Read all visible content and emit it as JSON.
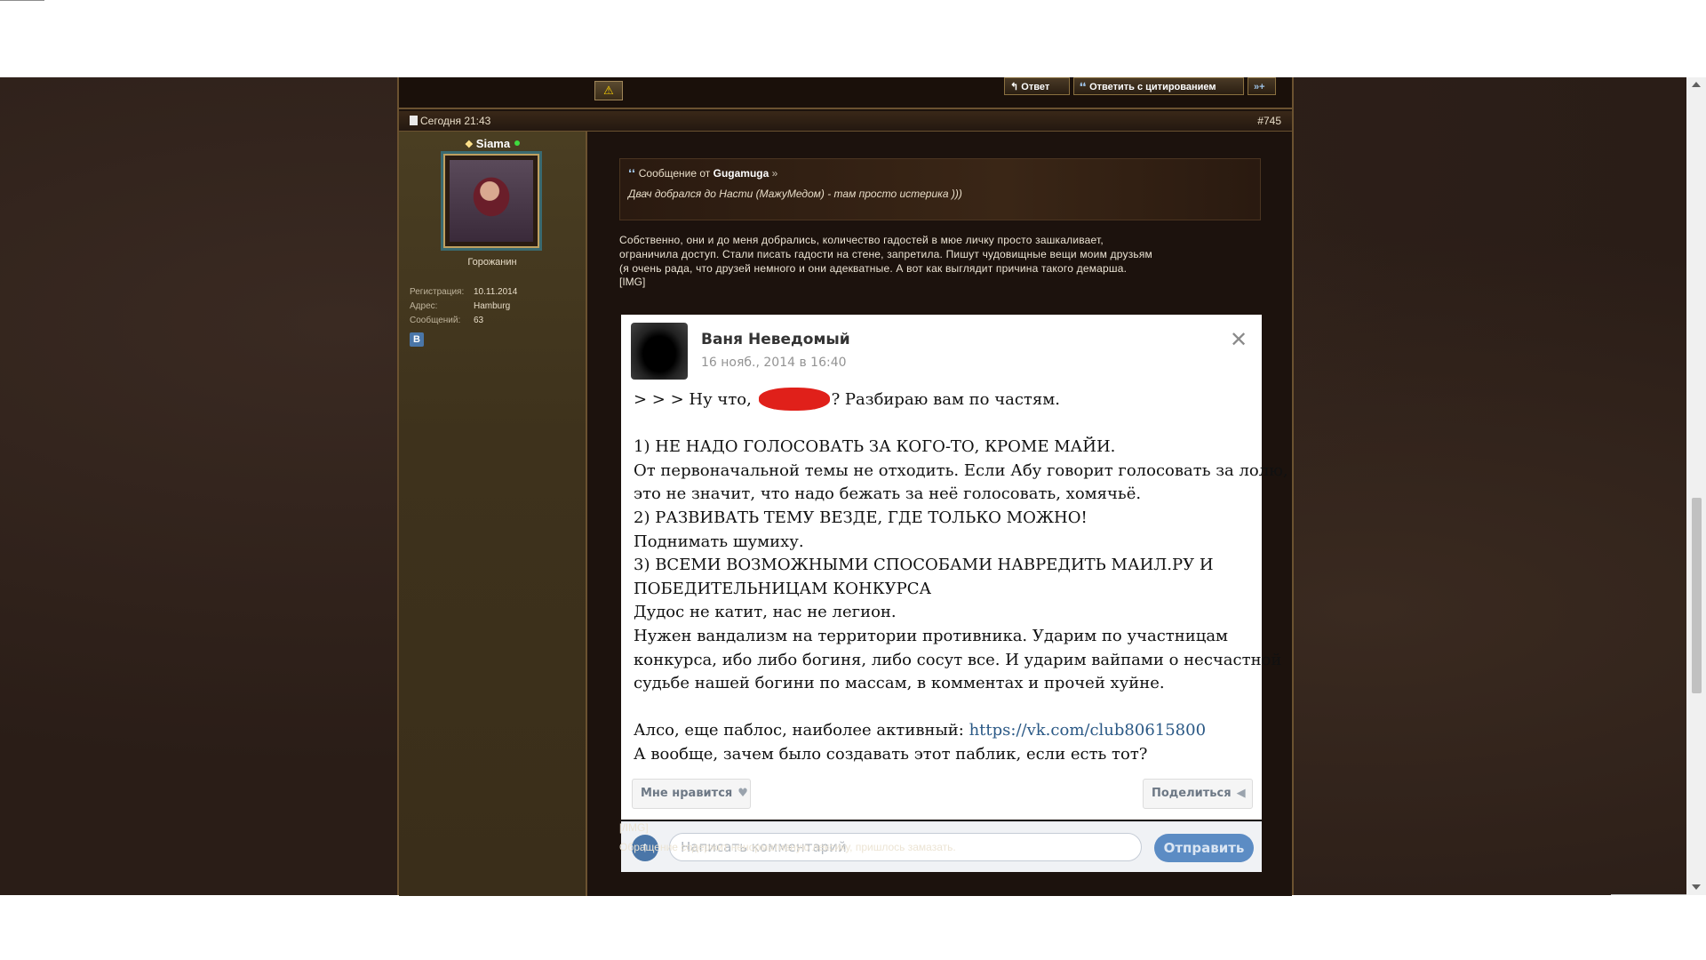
{
  "toolbar": {
    "warn_icon": "warning-icon",
    "reply_label": "Ответ",
    "quote_reply_label": "Ответить с цитированием",
    "multiquote_label": "»+"
  },
  "post": {
    "date": "Сегодня 21:43",
    "number": "#745",
    "quote": {
      "prefix": "Сообщение от",
      "author": "Gugamuga",
      "text": "Двач добрался до Насти (МажуМедом) - там просто истерика )))"
    },
    "body_lines": [
      "Собственно, они и до меня добрались, количество гадостей в мюе личку просто зашкаливает,",
      "ограничила доступ. Стали писать гадости на стене, запретила. Пишут чудовищные вещи моим друзьям",
      "(я очень рада, что друзей немного и они адекватные. А вот как выглядит причина такого демарша."
    ],
    "img_open": "[IMG]",
    "img_close": "[/IMG]",
    "footer": "Обращение содержит ненормативную лексику, пришлось замазать."
  },
  "user": {
    "name": "Siama",
    "title": "Горожанин",
    "info": [
      {
        "label": "Регистрация:",
        "value": "10.11.2014"
      },
      {
        "label": "Адрес:",
        "value": "Hamburg"
      },
      {
        "label": "Сообщений:",
        "value": "63"
      }
    ],
    "vk_label": "В"
  },
  "vk_post": {
    "author": "Ваня Неведомый",
    "date": "16 нояб., 2014 в 16:40",
    "line1_before": "> > > Ну что, ",
    "line1_after": "? Разбираю вам по частям.",
    "lines": [
      "",
      "1) НЕ НАДО ГОЛОСОВАТЬ ЗА КОГО-ТО, КРОМЕ МАЙИ.",
      "От первоначальной темы не отходить. Если Абу говорит голосовать за лолю,",
      "это не значит, что надо бежать за неё голосовать, хомячьё.",
      "2) РАЗВИВАТЬ ТЕМУ ВЕЗДЕ, ГДЕ ТОЛЬКО МОЖНО!",
      "Поднимать шумиху.",
      "3) ВСЕМИ ВОЗМОЖНЫМИ СПОСОБАМИ НАВРЕДИТЬ МАИЛ.РУ И",
      "ПОБЕДИТЕЛЬНИЦАМ КОНКУРСА",
      "Дудос не катит, нас не легион.",
      "Нужен вандализм на территории противника. Ударим по участницам",
      "конкурса, ибо либо богиня, либо сосут все. И ударим вайпами о несчастной",
      "судьбе нашей богини по массам, в комментах и прочей хуйне.",
      ""
    ],
    "link_prefix": "Алсо, еще паблос, наиболее активный: ",
    "link": "https://vk.com/club80615800",
    "last_line": "А вообще, зачем было создавать этот паблик, если есть тот?",
    "like_label": "Мне нравится",
    "share_label": "Поделиться",
    "comment_placeholder": "Написать комментарий",
    "send_label": "Отправить"
  }
}
